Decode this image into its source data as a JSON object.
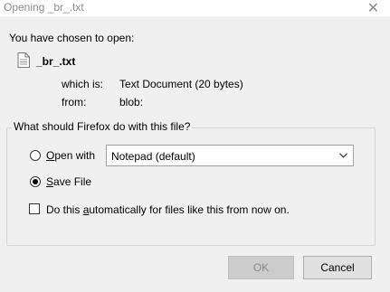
{
  "window": {
    "title": "Opening _br_.txt",
    "close": "✕"
  },
  "intro": "You have chosen to open:",
  "file": {
    "name": "_br_.txt",
    "which_label": "which is:",
    "which_value": "Text Document (20 bytes)",
    "from_label": "from:",
    "from_value": "blob:"
  },
  "group": {
    "legend": "What should Firefox do with this file?",
    "open_with": {
      "access_key": "O",
      "rest": "pen with",
      "checked": false
    },
    "app_select": {
      "value": "Notepad (default)"
    },
    "save_file": {
      "access_key": "S",
      "rest": "ave File",
      "checked": true
    },
    "auto": {
      "pre": "Do this ",
      "access_key": "a",
      "rest": "utomatically for files like this from now on.",
      "checked": false
    }
  },
  "buttons": {
    "ok": "OK",
    "cancel": "Cancel"
  },
  "icons": {
    "file": "file-icon",
    "chevron": "chevron-down-icon",
    "close": "close-icon"
  }
}
